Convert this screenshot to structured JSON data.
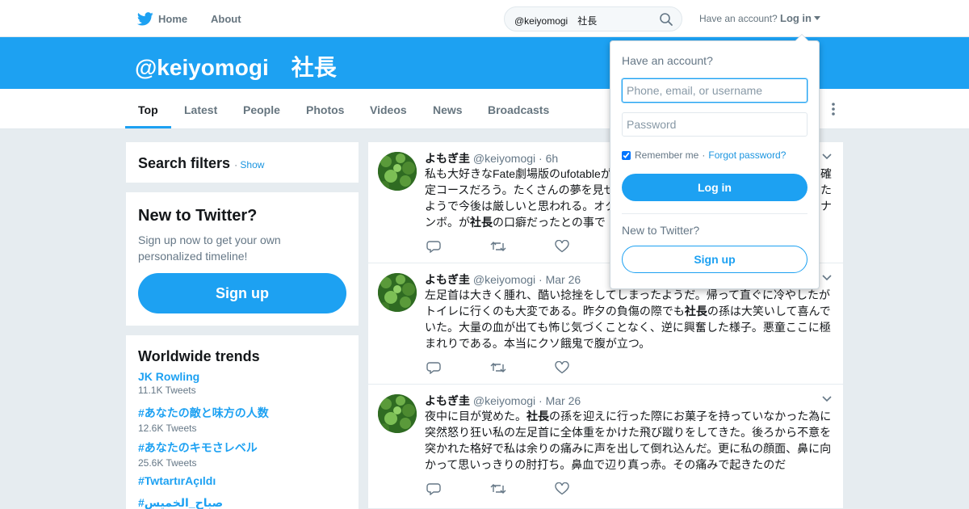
{
  "colors": {
    "brand": "#1da1f2",
    "background": "#e6ecf0",
    "link": "#1b95e0"
  },
  "nav": {
    "home_label": "Home",
    "about_label": "About",
    "search_value": "@keiyomogi　社長",
    "have_account_text": "Have an account?",
    "login_label": "Log in"
  },
  "header": {
    "query_title": "@keiyomogi　社長"
  },
  "tabs": [
    {
      "label": "Top",
      "active": true
    },
    {
      "label": "Latest"
    },
    {
      "label": "People"
    },
    {
      "label": "Photos"
    },
    {
      "label": "Videos"
    },
    {
      "label": "News"
    },
    {
      "label": "Broadcasts"
    }
  ],
  "sidebar": {
    "search_filters": {
      "title": "Search filters",
      "show_label": "Show"
    },
    "new_to_twitter": {
      "title": "New to Twitter?",
      "subtitle": "Sign up now to get your own personalized timeline!",
      "signup_label": "Sign up"
    },
    "trends": {
      "title": "Worldwide trends",
      "items": [
        {
          "name": "JK Rowling",
          "count": "11.1K Tweets"
        },
        {
          "name": "#あなたの敵と味方の人数",
          "count": "12.6K Tweets"
        },
        {
          "name": "#あなたのキモさレベル",
          "count": "25.6K Tweets"
        },
        {
          "name": "#TwtartırAçıldı",
          "count": ""
        },
        {
          "name": "#صباح_الخميس",
          "count": ""
        }
      ]
    }
  },
  "tweets": [
    {
      "name": "よもぎ圭",
      "handle": "@keiyomogi",
      "time": "6h",
      "lines": [
        [
          "私も大好きなFate劇場版のufotableが",
          "",
          "確"
        ],
        [
          "定コースだろう。たくさんの夢を見せ",
          "",
          "た"
        ],
        [
          "ようで今後は厳しいと思われる。オク",
          "",
          "ナ"
        ],
        [
          "ンボ。が",
          "社長",
          "の口癖だったとの事で"
        ]
      ]
    },
    {
      "name": "よもぎ圭",
      "handle": "@keiyomogi",
      "time": "Mar 26",
      "lines": [
        [
          "左足首は大きく腫れ、酷い捻挫をしてしまったようだ。帰って直ぐに冷やしたが",
          "",
          ""
        ],
        [
          "トイレに行くのも大変である。昨夕の負傷の際でも",
          "社長",
          "の孫は大笑いして喜んで"
        ],
        [
          "いた。大量の血が出ても怖じ気づくことなく、逆に興奮した様子。悪童ここに極",
          "",
          ""
        ],
        [
          "まれりである。本当にクソ餓鬼で腹が立つ。",
          "",
          ""
        ]
      ]
    },
    {
      "name": "よもぎ圭",
      "handle": "@keiyomogi",
      "time": "Mar 26",
      "lines": [
        [
          "夜中に目が覚めた。",
          "社長",
          "の孫を迎えに行った際にお菓子を持っていなかった為に"
        ],
        [
          "突然怒り狂い私の左足首に全体重をかけた飛び蹴りをしてきた。後ろから不意を",
          "",
          ""
        ],
        [
          "突かれた格好で私は余りの痛みに声を出して倒れ込んだ。更に私の顔面、鼻に向",
          "",
          ""
        ],
        [
          "かって思いっきりの肘打ち。鼻血で辺り真っ赤。その痛みで起きたのだ",
          "",
          ""
        ]
      ]
    }
  ],
  "login_dropdown": {
    "heading": "Have an account?",
    "username_placeholder": "Phone, email, or username",
    "password_placeholder": "Password",
    "remember_label": "Remember me",
    "separator": "·",
    "forgot_label": "Forgot password?",
    "login_button": "Log in",
    "new_text": "New to Twitter?",
    "signup_button": "Sign up"
  }
}
